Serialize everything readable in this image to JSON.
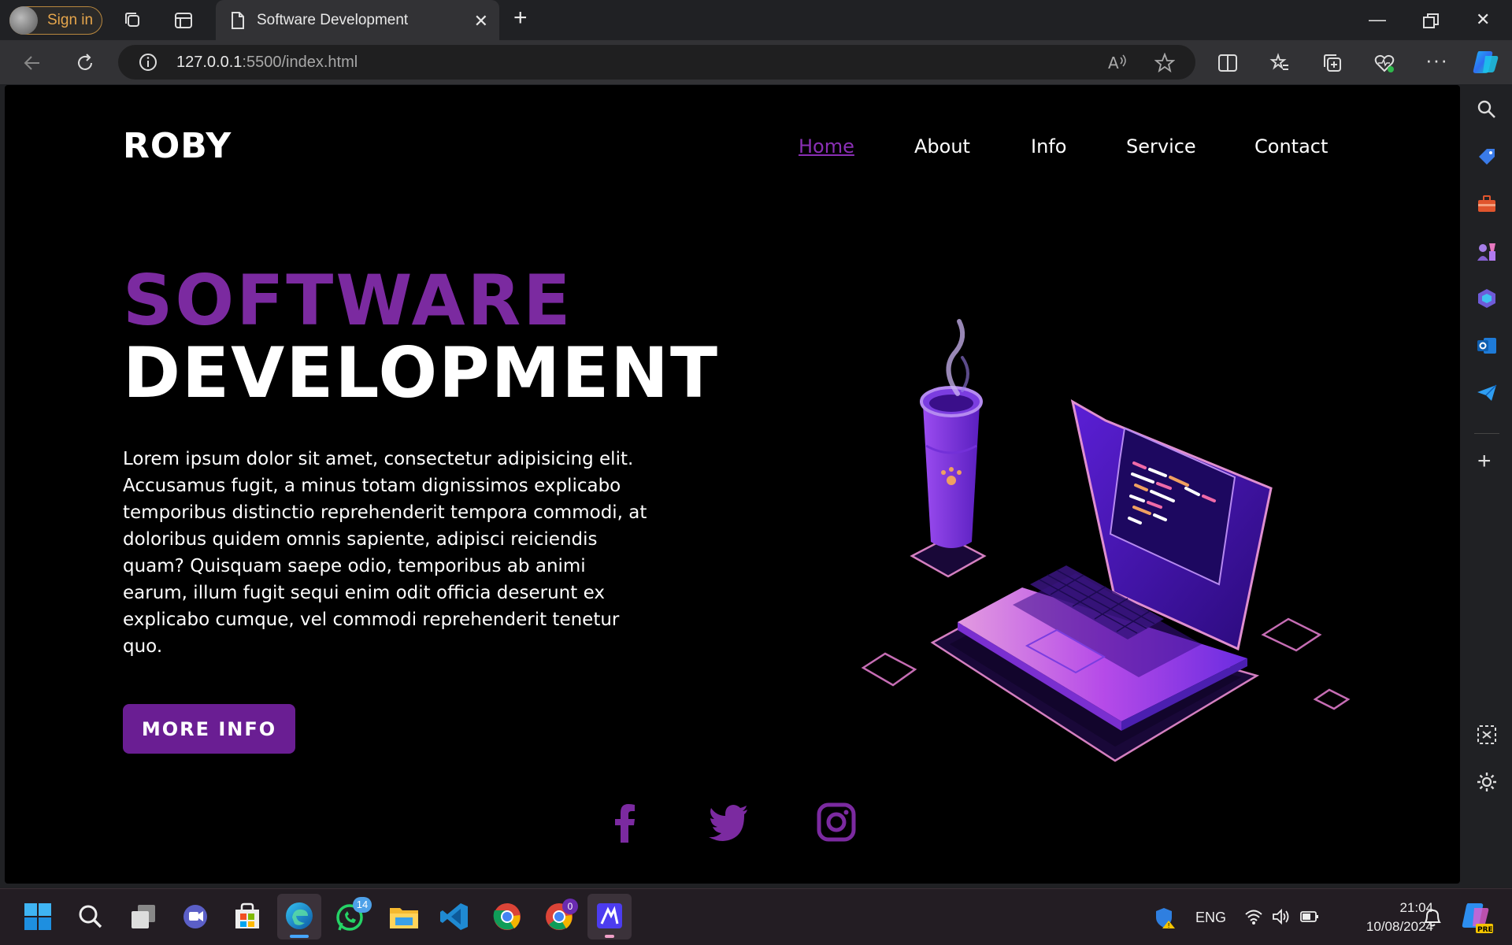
{
  "browser": {
    "signin_label": "Sign in",
    "tab_title": "Software Development",
    "url_host": "127.0.0.1",
    "url_rest": ":5500/index.html"
  },
  "site": {
    "logo": "ROBY",
    "nav": [
      "Home",
      "About",
      "Info",
      "Service",
      "Contact"
    ],
    "active_nav": "Home",
    "headline_1": "SOFTWARE",
    "headline_2": "DEVELOPMENT",
    "paragraph": "Lorem ipsum dolor sit amet, consectetur adipisicing elit. Accusamus fugit, a minus totam dignissimos explicabo temporibus distinctio reprehenderit tempora commodi, at doloribus quidem omnis sapiente, adipisci reiciendis quam? Quisquam saepe odio, temporibus ab animi earum, illum fugit sequi enim odit officia deserunt ex explicabo cumque, vel commodi reprehenderit tenetur quo.",
    "button_label": "MORE INFO",
    "social": [
      "facebook-icon",
      "twitter-icon",
      "instagram-icon"
    ],
    "accent_color": "#7b2aa0"
  },
  "taskbar": {
    "whatsapp_badge": "14",
    "chrome_badge": "0",
    "language": "ENG",
    "time": "21:04",
    "date": "10/08/2024"
  }
}
